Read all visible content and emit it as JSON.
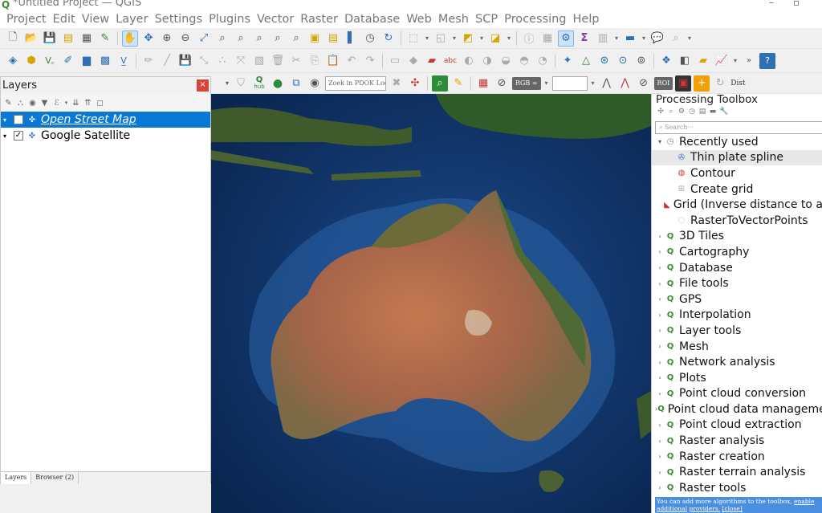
{
  "window": {
    "title": "*Untitled Project — QGIS"
  },
  "menubar": [
    "Project",
    "Edit",
    "View",
    "Layer",
    "Settings",
    "Plugins",
    "Vector",
    "Raster",
    "Database",
    "Web",
    "Mesh",
    "SCP",
    "Processing",
    "Help"
  ],
  "toolbar3": {
    "search_placeholder": "Zoek in PDOK Loc···",
    "rgb_label": "RGB =",
    "roi_label": "ROI",
    "dist_label": "Dist",
    "hub_label": "hub"
  },
  "layers_panel": {
    "title": "Layers",
    "close_label": "×",
    "layers": [
      {
        "name": "Open Street Map",
        "checked": false,
        "selected": true
      },
      {
        "name": "Google Satellite",
        "checked": true,
        "selected": false
      }
    ],
    "tabs": [
      "Layers",
      "Browser (2)"
    ]
  },
  "processing": {
    "title": "Processing Toolbox",
    "search_placeholder": "Search···",
    "recently_used_label": "Recently used",
    "recent": [
      "Thin plate spline",
      "Contour",
      "Create grid",
      "Grid (Inverse distance to a",
      "RasterToVectorPoints"
    ],
    "groups": [
      "3D Tiles",
      "Cartography",
      "Database",
      "File tools",
      "GPS",
      "Interpolation",
      "Layer tools",
      "Mesh",
      "Network analysis",
      "Plots",
      "Point cloud conversion",
      "Point cloud data management",
      "Point cloud extraction",
      "Raster analysis",
      "Raster creation",
      "Raster terrain analysis",
      "Raster tools"
    ],
    "banner_text": "You can add more algorithms to the toolbox,",
    "banner_link1": "enable additional",
    "banner_link2": "providers.",
    "banner_close": "[close]"
  },
  "colors": {
    "selection": "#0a78d7",
    "banner": "#4a8ee0",
    "qgis_green": "#3a8a2f"
  }
}
